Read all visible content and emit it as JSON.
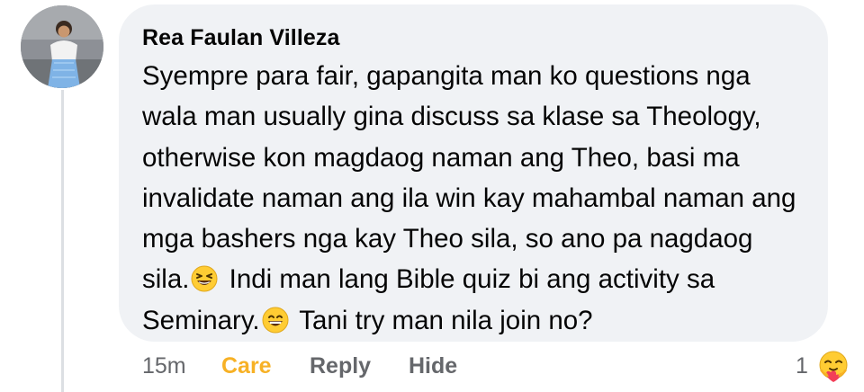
{
  "comment": {
    "author": "Rea Faulan Villeza",
    "lines": [
      "Syempre para fair, gapangita man ko questions nga",
      "wala man usually gina discuss sa klase sa Theology,",
      "otherwise kon magdaog naman ang Theo, basi ma",
      "invalidate naman ang ila win kay mahambal naman ang",
      "mga bashers nga kay Theo sila, so ano pa nagdaog"
    ],
    "line6_before": "sila.",
    "line6_emoji": "grinning-squinting-face",
    "line6_after": " Indi man lang Bible quiz bi ang activity sa",
    "line7_before": "Seminary.",
    "line7_emoji": "grinning-face-with-smiling-eyes",
    "line7_after": " Tani try man nila join no?"
  },
  "actions": {
    "time": "15m",
    "care_label": "Care",
    "reply_label": "Reply",
    "hide_label": "Hide"
  },
  "reactions": {
    "count": "1",
    "icon": "care-reaction"
  },
  "colors": {
    "bubble": "#f0f2f5",
    "care": "#f7b125",
    "muted": "#65676b"
  }
}
